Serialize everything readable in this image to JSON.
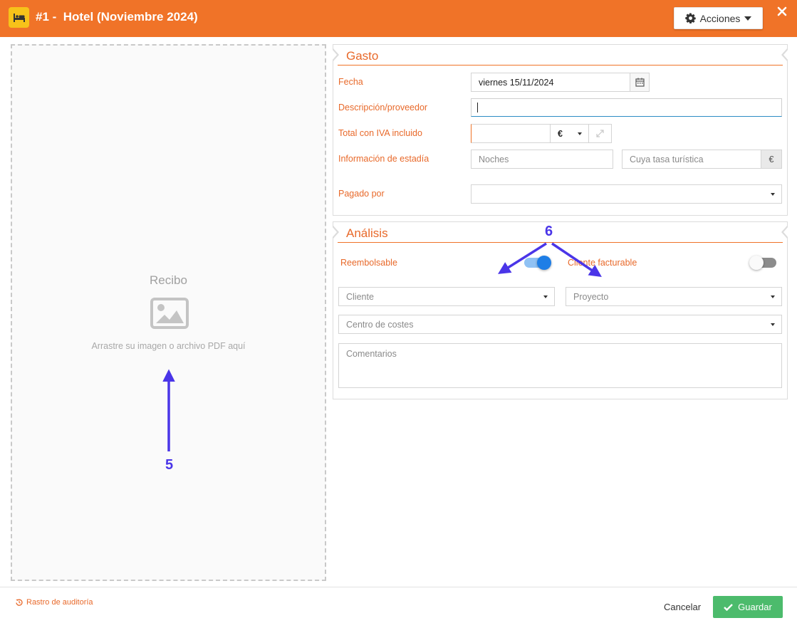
{
  "header": {
    "title": "#1 -  Hotel (Noviembre 2024)",
    "icon": "bed-icon",
    "actions_label": "Acciones"
  },
  "receipt": {
    "title": "Recibo",
    "hint": "Arrastre su imagen o archivo PDF aquí"
  },
  "gasto": {
    "section_title": "Gasto",
    "fecha_label": "Fecha",
    "fecha_value": "viernes 15/11/2024",
    "descripcion_label": "Descripción/proveedor",
    "descripcion_value": "",
    "total_label": "Total con IVA incluido",
    "total_value": "",
    "currency": "€",
    "estadia_label": "Información de estadía",
    "noches_placeholder": "Noches",
    "tasa_placeholder": "Cuya tasa turística",
    "tasa_unit": "€",
    "pagado_label": "Pagado por",
    "pagado_value": ""
  },
  "analisis": {
    "section_title": "Análisis",
    "reembolsable_label": "Reembolsable",
    "reembolsable_on": true,
    "cliente_facturable_label": "Cliente facturable",
    "cliente_facturable_on": false,
    "cliente_placeholder": "Cliente",
    "proyecto_placeholder": "Proyecto",
    "centro_placeholder": "Centro de costes",
    "comentarios_placeholder": "Comentarios"
  },
  "footer": {
    "audit_label": "Rastro de auditoría",
    "cancel_label": "Cancelar",
    "save_label": "Guardar"
  },
  "annotations": {
    "label_5": "5",
    "label_6": "6"
  },
  "colors": {
    "header": "#f07328",
    "accent": "#e8692a",
    "save": "#4cbb6c",
    "toggle_on": "#1e7ee6",
    "annotation": "#4a35e8"
  }
}
